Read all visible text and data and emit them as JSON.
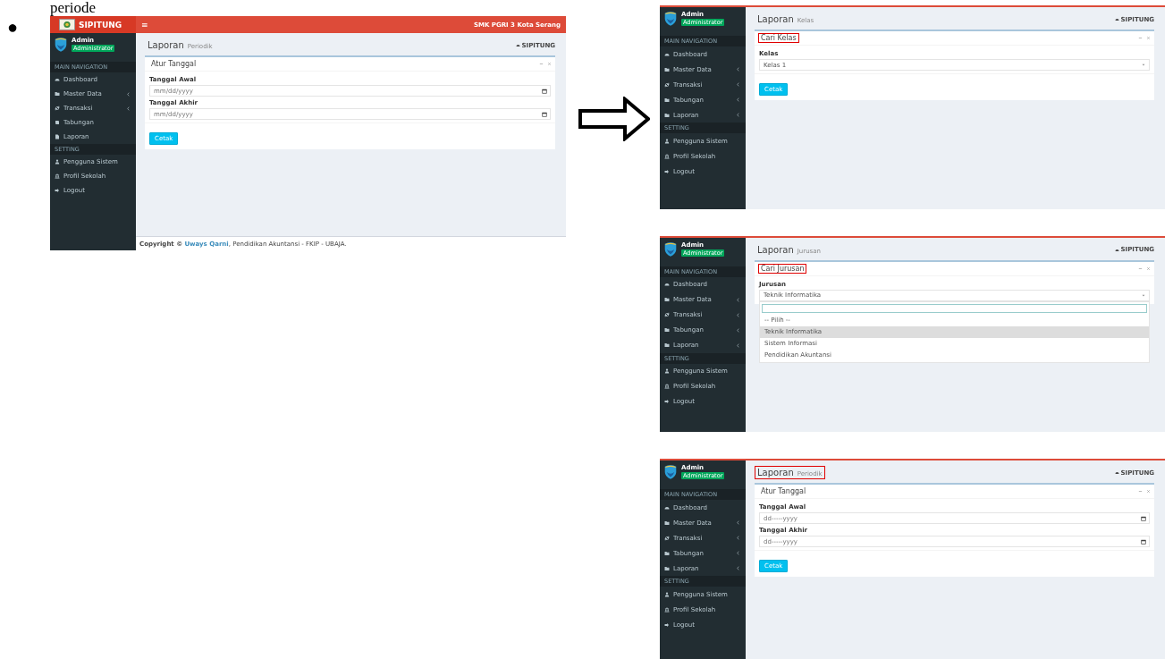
{
  "document": {
    "heading_fragment": "periode",
    "bullet": "●"
  },
  "screens": [
    {
      "kind": "dates",
      "heading_marked": false,
      "title_marked": false,
      "header": {
        "brand": "SIPITUNG",
        "menu_glyph": "≡",
        "school": "SMK PGRI 3 Kota Serang"
      },
      "user": {
        "name": "Admin",
        "role": "Administrator"
      },
      "nav": [
        {
          "kind": "section",
          "label": "MAIN NAVIGATION"
        },
        {
          "kind": "dashboard",
          "label": "Dashboard",
          "caret": false
        },
        {
          "kind": "folder",
          "label": "Master Data",
          "caret": true
        },
        {
          "kind": "refresh",
          "label": "Transaksi",
          "caret": true
        },
        {
          "kind": "book",
          "label": "Tabungan",
          "caret": false
        },
        {
          "kind": "file",
          "label": "Laporan",
          "caret": false
        },
        {
          "kind": "section",
          "label": "SETTING"
        },
        {
          "kind": "user",
          "label": "Pengguna Sistem",
          "caret": false
        },
        {
          "kind": "bank",
          "label": "Profil Sekolah",
          "caret": false
        },
        {
          "kind": "logout",
          "label": "Logout",
          "caret": false
        }
      ],
      "page_title": "Laporan",
      "page_subtitle": "Periodik",
      "breadcrumb": "SIPITUNG",
      "box_title": "Atur Tanggal",
      "fields": [
        {
          "label": "Tanggal Awal",
          "placeholder": "mm/dd/yyyy"
        },
        {
          "label": "Tanggal Akhir",
          "placeholder": "mm/dd/yyyy"
        }
      ],
      "button": "Cetak",
      "footer": {
        "prefix": "Copyright ©",
        "link": "Uways Qarni",
        "suffix": ", Pendidikan Akuntansi - FKIP - UBAJA."
      }
    },
    {
      "kind": "select",
      "heading_marked": false,
      "title_marked": true,
      "user": {
        "name": "Admin",
        "role": "Administrator"
      },
      "nav": [
        {
          "kind": "section",
          "label": "MAIN NAVIGATION"
        },
        {
          "kind": "dashboard",
          "label": "Dashboard",
          "caret": false
        },
        {
          "kind": "folder",
          "label": "Master Data",
          "caret": true
        },
        {
          "kind": "refresh",
          "label": "Transaksi",
          "caret": true
        },
        {
          "kind": "folder",
          "label": "Tabungan",
          "caret": true
        },
        {
          "kind": "folder",
          "label": "Laporan",
          "caret": true
        },
        {
          "kind": "section",
          "label": "SETTING"
        },
        {
          "kind": "user",
          "label": "Pengguna Sistem",
          "caret": false
        },
        {
          "kind": "bank",
          "label": "Profil Sekolah",
          "caret": false
        },
        {
          "kind": "logout",
          "label": "Logout",
          "caret": false
        }
      ],
      "page_title": "Laporan",
      "page_subtitle": "Kelas",
      "breadcrumb": "SIPITUNG",
      "box_title": "Cari Kelas",
      "select": {
        "label": "Kelas",
        "value": "Kelas 1"
      },
      "button": "Cetak"
    },
    {
      "kind": "dropdown",
      "heading_marked": false,
      "title_marked": true,
      "user": {
        "name": "Admin",
        "role": "Administrator"
      },
      "nav": [
        {
          "kind": "section",
          "label": "MAIN NAVIGATION"
        },
        {
          "kind": "dashboard",
          "label": "Dashboard",
          "caret": false
        },
        {
          "kind": "folder",
          "label": "Master Data",
          "caret": true
        },
        {
          "kind": "refresh",
          "label": "Transaksi",
          "caret": true
        },
        {
          "kind": "folder",
          "label": "Tabungan",
          "caret": true
        },
        {
          "kind": "folder",
          "label": "Laporan",
          "caret": true
        },
        {
          "kind": "section",
          "label": "SETTING"
        },
        {
          "kind": "user",
          "label": "Pengguna Sistem",
          "caret": false
        },
        {
          "kind": "bank",
          "label": "Profil Sekolah",
          "caret": false
        },
        {
          "kind": "logout",
          "label": "Logout",
          "caret": false
        }
      ],
      "page_title": "Laporan",
      "page_subtitle": "Jurusan",
      "breadcrumb": "SIPITUNG",
      "box_title": "Cari Jurusan",
      "select": {
        "label": "Jurusan",
        "value": "Teknik Informatika",
        "options": [
          {
            "label": "-- Pilih --",
            "selected": false
          },
          {
            "label": "Teknik Informatika",
            "selected": true
          },
          {
            "label": "Sistem Informasi",
            "selected": false
          },
          {
            "label": "Pendidikan Akuntansi",
            "selected": false
          }
        ]
      }
    },
    {
      "kind": "dates",
      "heading_marked": true,
      "title_marked": false,
      "user": {
        "name": "Admin",
        "role": "Administrator"
      },
      "nav": [
        {
          "kind": "section",
          "label": "MAIN NAVIGATION"
        },
        {
          "kind": "dashboard",
          "label": "Dashboard",
          "caret": false
        },
        {
          "kind": "folder",
          "label": "Master Data",
          "caret": true
        },
        {
          "kind": "refresh",
          "label": "Transaksi",
          "caret": true
        },
        {
          "kind": "folder",
          "label": "Tabungan",
          "caret": true
        },
        {
          "kind": "folder",
          "label": "Laporan",
          "caret": true
        },
        {
          "kind": "section",
          "label": "SETTING"
        },
        {
          "kind": "user",
          "label": "Pengguna Sistem",
          "caret": false
        },
        {
          "kind": "bank",
          "label": "Profil Sekolah",
          "caret": false
        },
        {
          "kind": "logout",
          "label": "Logout",
          "caret": false
        }
      ],
      "page_title": "Laporan",
      "page_subtitle": "Periodik",
      "breadcrumb": "SIPITUNG",
      "box_title": "Atur Tanggal",
      "fields": [
        {
          "label": "Tanggal Awal",
          "placeholder": "dd-----yyyy"
        },
        {
          "label": "Tanggal Akhir",
          "placeholder": "dd-----yyyy"
        }
      ],
      "button": "Cetak"
    }
  ]
}
